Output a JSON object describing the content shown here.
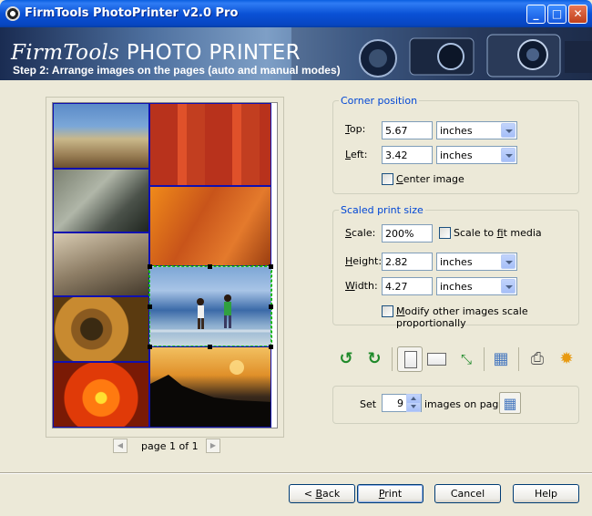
{
  "window": {
    "title": "FirmTools PhotoPrinter v2.0 Pro",
    "minimize": "_",
    "maximize": "□",
    "close": "✕"
  },
  "banner": {
    "logo_script": "FirmTools",
    "logo_main": " PHOTO PRINTER",
    "step": "Step 2: Arrange images on the pages (auto and manual modes)"
  },
  "preview": {
    "photos": [
      {
        "name": "beach",
        "selected": false
      },
      {
        "name": "red-grass",
        "selected": false
      },
      {
        "name": "bicycles",
        "selected": false
      },
      {
        "name": "orange-dunes",
        "selected": false
      },
      {
        "name": "sand-dunes",
        "selected": false
      },
      {
        "name": "people-at-beach",
        "selected": true
      },
      {
        "name": "rusty-gear",
        "selected": false
      },
      {
        "name": "orange-flower",
        "selected": false
      },
      {
        "name": "sunset-silhouette",
        "selected": false
      }
    ],
    "pager": {
      "prev_icon": "◀",
      "label": "page 1 of 1",
      "next_icon": "▶"
    }
  },
  "corner_position": {
    "title": "Corner position",
    "top_label_u": "T",
    "top_label_rest": "op:",
    "top_value": "5.67",
    "top_unit": "inches",
    "left_label_u": "L",
    "left_label_rest": "eft:",
    "left_value": "3.42",
    "left_unit": "inches",
    "center_label_u": "C",
    "center_label_rest": "enter image",
    "center_checked": false
  },
  "scaled_print_size": {
    "title": "Scaled print size",
    "scale_label_u": "S",
    "scale_label_rest": "cale:",
    "scale_value": "200%",
    "fit_label_pre": "Scale to ",
    "fit_label_u": "f",
    "fit_label_rest": "it media",
    "fit_checked": false,
    "height_label_u": "H",
    "height_label_rest": "eight:",
    "height_value": "2.82",
    "height_unit": "inches",
    "width_label_u": "W",
    "width_label_rest": "idth:",
    "width_value": "4.27",
    "width_unit": "inches",
    "modify_label_u": "M",
    "modify_label_rest": "odify other images scale proportionally",
    "modify_checked": false
  },
  "toolbar": {
    "rotate_left": "↺",
    "rotate_right": "↻",
    "fit_icon": "⤡",
    "layout_icon": "▦",
    "print_icon": "⎙",
    "settings_icon": "✹",
    "colors": {
      "green": "#1f8a2a",
      "orange": "#e89a10"
    }
  },
  "images_per_page": {
    "label_pre": "Set",
    "value": "9",
    "label_post": "images on page",
    "grid_icon": "▦"
  },
  "buttons": {
    "back_pre": "< ",
    "back_u": "B",
    "back_rest": "ack",
    "print_u": "P",
    "print_rest": "rint",
    "cancel": "Cancel",
    "help": "Help"
  }
}
